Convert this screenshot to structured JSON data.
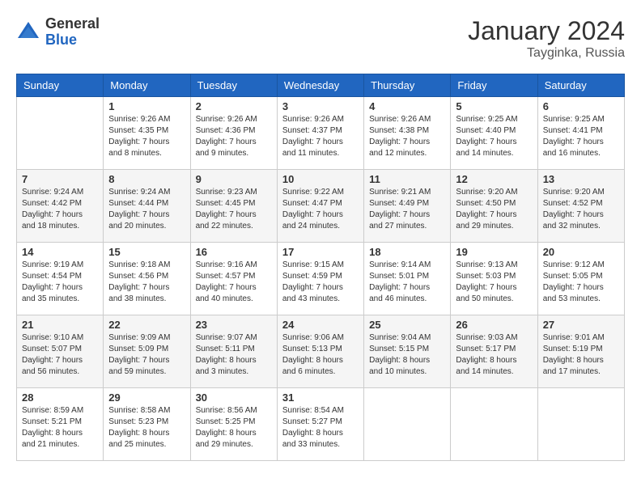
{
  "logo": {
    "general": "General",
    "blue": "Blue"
  },
  "title": {
    "month_year": "January 2024",
    "location": "Tayginka, Russia"
  },
  "days_of_week": [
    "Sunday",
    "Monday",
    "Tuesday",
    "Wednesday",
    "Thursday",
    "Friday",
    "Saturday"
  ],
  "weeks": [
    [
      {
        "day": "",
        "sunrise": "",
        "sunset": "",
        "daylight": ""
      },
      {
        "day": "1",
        "sunrise": "Sunrise: 9:26 AM",
        "sunset": "Sunset: 4:35 PM",
        "daylight": "Daylight: 7 hours and 8 minutes."
      },
      {
        "day": "2",
        "sunrise": "Sunrise: 9:26 AM",
        "sunset": "Sunset: 4:36 PM",
        "daylight": "Daylight: 7 hours and 9 minutes."
      },
      {
        "day": "3",
        "sunrise": "Sunrise: 9:26 AM",
        "sunset": "Sunset: 4:37 PM",
        "daylight": "Daylight: 7 hours and 11 minutes."
      },
      {
        "day": "4",
        "sunrise": "Sunrise: 9:26 AM",
        "sunset": "Sunset: 4:38 PM",
        "daylight": "Daylight: 7 hours and 12 minutes."
      },
      {
        "day": "5",
        "sunrise": "Sunrise: 9:25 AM",
        "sunset": "Sunset: 4:40 PM",
        "daylight": "Daylight: 7 hours and 14 minutes."
      },
      {
        "day": "6",
        "sunrise": "Sunrise: 9:25 AM",
        "sunset": "Sunset: 4:41 PM",
        "daylight": "Daylight: 7 hours and 16 minutes."
      }
    ],
    [
      {
        "day": "7",
        "sunrise": "Sunrise: 9:24 AM",
        "sunset": "Sunset: 4:42 PM",
        "daylight": "Daylight: 7 hours and 18 minutes."
      },
      {
        "day": "8",
        "sunrise": "Sunrise: 9:24 AM",
        "sunset": "Sunset: 4:44 PM",
        "daylight": "Daylight: 7 hours and 20 minutes."
      },
      {
        "day": "9",
        "sunrise": "Sunrise: 9:23 AM",
        "sunset": "Sunset: 4:45 PM",
        "daylight": "Daylight: 7 hours and 22 minutes."
      },
      {
        "day": "10",
        "sunrise": "Sunrise: 9:22 AM",
        "sunset": "Sunset: 4:47 PM",
        "daylight": "Daylight: 7 hours and 24 minutes."
      },
      {
        "day": "11",
        "sunrise": "Sunrise: 9:21 AM",
        "sunset": "Sunset: 4:49 PM",
        "daylight": "Daylight: 7 hours and 27 minutes."
      },
      {
        "day": "12",
        "sunrise": "Sunrise: 9:20 AM",
        "sunset": "Sunset: 4:50 PM",
        "daylight": "Daylight: 7 hours and 29 minutes."
      },
      {
        "day": "13",
        "sunrise": "Sunrise: 9:20 AM",
        "sunset": "Sunset: 4:52 PM",
        "daylight": "Daylight: 7 hours and 32 minutes."
      }
    ],
    [
      {
        "day": "14",
        "sunrise": "Sunrise: 9:19 AM",
        "sunset": "Sunset: 4:54 PM",
        "daylight": "Daylight: 7 hours and 35 minutes."
      },
      {
        "day": "15",
        "sunrise": "Sunrise: 9:18 AM",
        "sunset": "Sunset: 4:56 PM",
        "daylight": "Daylight: 7 hours and 38 minutes."
      },
      {
        "day": "16",
        "sunrise": "Sunrise: 9:16 AM",
        "sunset": "Sunset: 4:57 PM",
        "daylight": "Daylight: 7 hours and 40 minutes."
      },
      {
        "day": "17",
        "sunrise": "Sunrise: 9:15 AM",
        "sunset": "Sunset: 4:59 PM",
        "daylight": "Daylight: 7 hours and 43 minutes."
      },
      {
        "day": "18",
        "sunrise": "Sunrise: 9:14 AM",
        "sunset": "Sunset: 5:01 PM",
        "daylight": "Daylight: 7 hours and 46 minutes."
      },
      {
        "day": "19",
        "sunrise": "Sunrise: 9:13 AM",
        "sunset": "Sunset: 5:03 PM",
        "daylight": "Daylight: 7 hours and 50 minutes."
      },
      {
        "day": "20",
        "sunrise": "Sunrise: 9:12 AM",
        "sunset": "Sunset: 5:05 PM",
        "daylight": "Daylight: 7 hours and 53 minutes."
      }
    ],
    [
      {
        "day": "21",
        "sunrise": "Sunrise: 9:10 AM",
        "sunset": "Sunset: 5:07 PM",
        "daylight": "Daylight: 7 hours and 56 minutes."
      },
      {
        "day": "22",
        "sunrise": "Sunrise: 9:09 AM",
        "sunset": "Sunset: 5:09 PM",
        "daylight": "Daylight: 7 hours and 59 minutes."
      },
      {
        "day": "23",
        "sunrise": "Sunrise: 9:07 AM",
        "sunset": "Sunset: 5:11 PM",
        "daylight": "Daylight: 8 hours and 3 minutes."
      },
      {
        "day": "24",
        "sunrise": "Sunrise: 9:06 AM",
        "sunset": "Sunset: 5:13 PM",
        "daylight": "Daylight: 8 hours and 6 minutes."
      },
      {
        "day": "25",
        "sunrise": "Sunrise: 9:04 AM",
        "sunset": "Sunset: 5:15 PM",
        "daylight": "Daylight: 8 hours and 10 minutes."
      },
      {
        "day": "26",
        "sunrise": "Sunrise: 9:03 AM",
        "sunset": "Sunset: 5:17 PM",
        "daylight": "Daylight: 8 hours and 14 minutes."
      },
      {
        "day": "27",
        "sunrise": "Sunrise: 9:01 AM",
        "sunset": "Sunset: 5:19 PM",
        "daylight": "Daylight: 8 hours and 17 minutes."
      }
    ],
    [
      {
        "day": "28",
        "sunrise": "Sunrise: 8:59 AM",
        "sunset": "Sunset: 5:21 PM",
        "daylight": "Daylight: 8 hours and 21 minutes."
      },
      {
        "day": "29",
        "sunrise": "Sunrise: 8:58 AM",
        "sunset": "Sunset: 5:23 PM",
        "daylight": "Daylight: 8 hours and 25 minutes."
      },
      {
        "day": "30",
        "sunrise": "Sunrise: 8:56 AM",
        "sunset": "Sunset: 5:25 PM",
        "daylight": "Daylight: 8 hours and 29 minutes."
      },
      {
        "day": "31",
        "sunrise": "Sunrise: 8:54 AM",
        "sunset": "Sunset: 5:27 PM",
        "daylight": "Daylight: 8 hours and 33 minutes."
      },
      {
        "day": "",
        "sunrise": "",
        "sunset": "",
        "daylight": ""
      },
      {
        "day": "",
        "sunrise": "",
        "sunset": "",
        "daylight": ""
      },
      {
        "day": "",
        "sunrise": "",
        "sunset": "",
        "daylight": ""
      }
    ]
  ]
}
